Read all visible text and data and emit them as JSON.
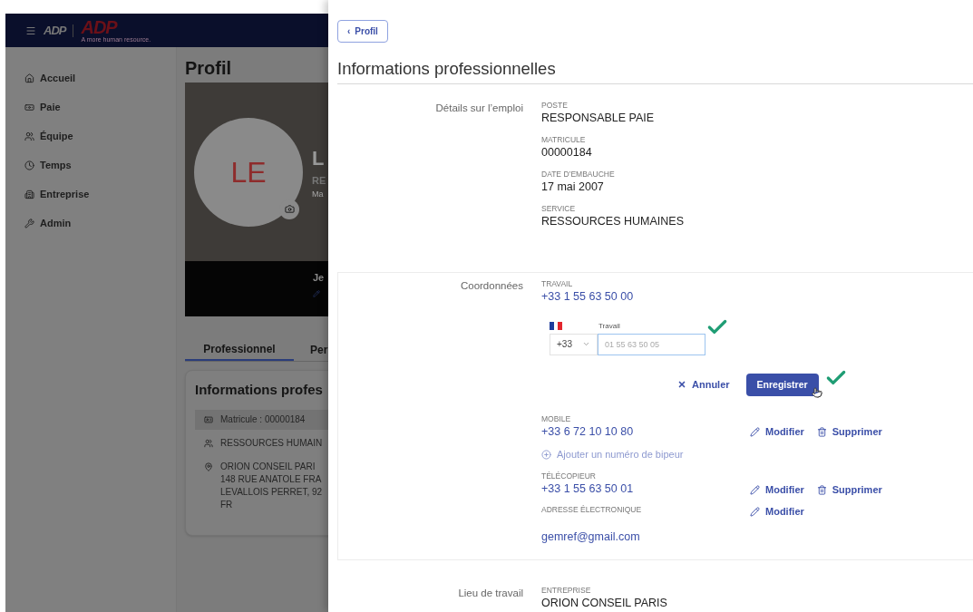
{
  "header": {
    "logos": [
      "ADP",
      "ADP"
    ],
    "tagline": "A more human resource."
  },
  "sidebar": {
    "items": [
      {
        "kind": "home",
        "label": "Accueil"
      },
      {
        "kind": "money",
        "label": "Paie"
      },
      {
        "kind": "team",
        "label": "Équipe"
      },
      {
        "kind": "clock",
        "label": "Temps"
      },
      {
        "kind": "building",
        "label": "Entreprise"
      },
      {
        "kind": "wrench",
        "label": "Admin"
      }
    ]
  },
  "profile": {
    "title": "Profil",
    "initials": "LE",
    "name": "L",
    "subtitle": "RE",
    "subline": "Ma",
    "strip_text": "Je",
    "tabs": [
      {
        "label": "Professionnel",
        "selected": true
      },
      {
        "label": "Per",
        "selected": false
      }
    ],
    "card": {
      "title": "Informations profes",
      "rows": [
        {
          "kind": "badge",
          "lines": [
            "Matricule : 00000184"
          ],
          "highlighted": true
        },
        {
          "kind": "team",
          "lines": [
            "RESSOURCES HUMAIN"
          ],
          "highlighted": false
        },
        {
          "kind": "pin",
          "lines": [
            "ORION CONSEIL PARI",
            "148 RUE ANATOLE FRA",
            "LEVALLOIS PERRET, 92",
            "FR"
          ],
          "highlighted": false
        }
      ]
    }
  },
  "panel": {
    "back": {
      "chevron": "‹",
      "label": "Profil"
    },
    "title": "Informations professionnelles",
    "job": {
      "label": "Détails sur l’emploi",
      "fields": [
        {
          "caption": "POSTE",
          "value": "RESPONSABLE PAIE"
        },
        {
          "caption": "MATRICULE",
          "value": "00000184"
        },
        {
          "caption": "DATE D’EMBAUCHE",
          "value": "17 mai 2007"
        },
        {
          "caption": "SERVICE",
          "value": "RESSOURCES HUMAINES"
        }
      ]
    },
    "contact": {
      "label": "Coordonnées",
      "work": {
        "caption": "TRAVAIL",
        "value": "+33 1 55 63 50 00"
      },
      "editor": {
        "field_label": "Travail",
        "country_code": "+33",
        "placeholder": "01 55 63 50 05",
        "cancel": "Annuler",
        "save": "Enregistrer"
      },
      "entries": [
        {
          "kind": "phone",
          "caption": "MOBILE",
          "value": "+33 6 72 10 10 80",
          "actions": [
            {
              "kind": "edit",
              "label": "Modifier"
            },
            {
              "kind": "delete",
              "label": "Supprimer"
            }
          ]
        },
        {
          "kind": "add",
          "label": "Ajouter un numéro de bipeur"
        },
        {
          "kind": "phone",
          "caption": "TÉLÉCOPIEUR",
          "value": "+33 1 55 63 50 01",
          "actions": [
            {
              "kind": "edit",
              "label": "Modifier"
            },
            {
              "kind": "delete",
              "label": "Supprimer"
            }
          ]
        },
        {
          "kind": "email",
          "caption": "ADRESSE ÉLECTRONIQUE",
          "value": "gemref@gmail.com",
          "actions": [
            {
              "kind": "edit",
              "label": "Modifier"
            }
          ]
        }
      ]
    },
    "workplace": {
      "label": "Lieu de travail",
      "fields": [
        {
          "caption": "ENTREPRISE",
          "value": "ORION CONSEIL PARIS"
        }
      ]
    }
  }
}
